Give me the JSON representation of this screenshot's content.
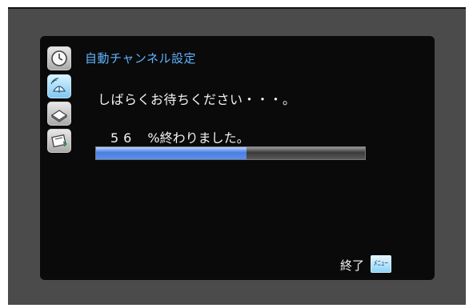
{
  "dialog": {
    "title": "自動チャンネル設定",
    "wait_message": "しばらくお待ちください・・・。",
    "progress": {
      "percent": 56,
      "percent_text": "56",
      "suffix": "%終わりました。"
    },
    "footer": {
      "end_label": "終了",
      "menu_button_label": "ﾒﾆｭｰ"
    }
  },
  "side_icons": [
    "clock-icon",
    "antenna-icon",
    "tray-icon",
    "card-icon"
  ],
  "colors": {
    "title": "#5fb4ff",
    "progress_fill": "#5b8ef0",
    "panel_bg": "#0a0a0a",
    "screen_bg": "#4b4b4b"
  }
}
